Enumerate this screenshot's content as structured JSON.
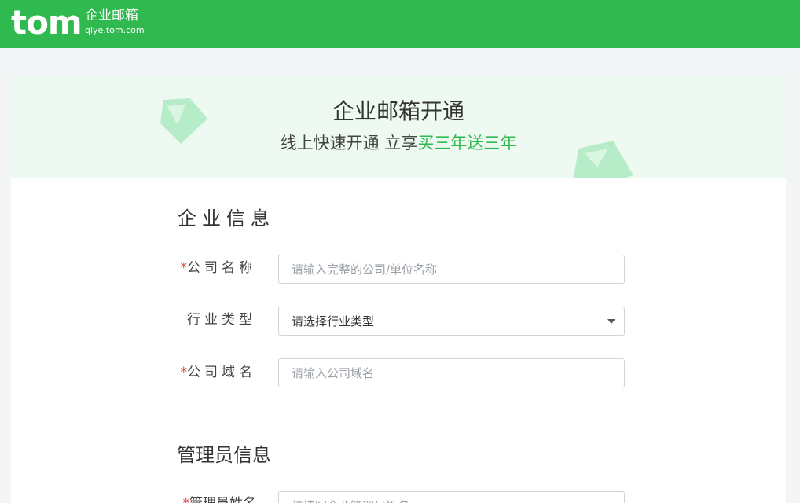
{
  "header": {
    "logo_text": "tom",
    "logo_cn": "企业邮箱",
    "logo_domain": "qiye.tom.com",
    "brand_color": "#2fb94e"
  },
  "banner": {
    "title": "企业邮箱开通",
    "subtitle_prefix": "线上快速开通 立享",
    "subtitle_highlight": "买三年送三年",
    "deco_icons": [
      "envelope-icon",
      "envelope-icon"
    ]
  },
  "sections": {
    "company": "企业信息",
    "admin": "管理员信息"
  },
  "form": {
    "required_mark": "*",
    "company_name": {
      "label": "公司名称",
      "placeholder": "请输入完整的公司/单位名称"
    },
    "industry": {
      "label": "行业类型",
      "value": "请选择行业类型"
    },
    "domain": {
      "label": "公司域名",
      "placeholder": "请输入公司域名"
    },
    "admin_name": {
      "label": "管理员姓名",
      "placeholder": "请填写企业管理员姓名"
    }
  }
}
